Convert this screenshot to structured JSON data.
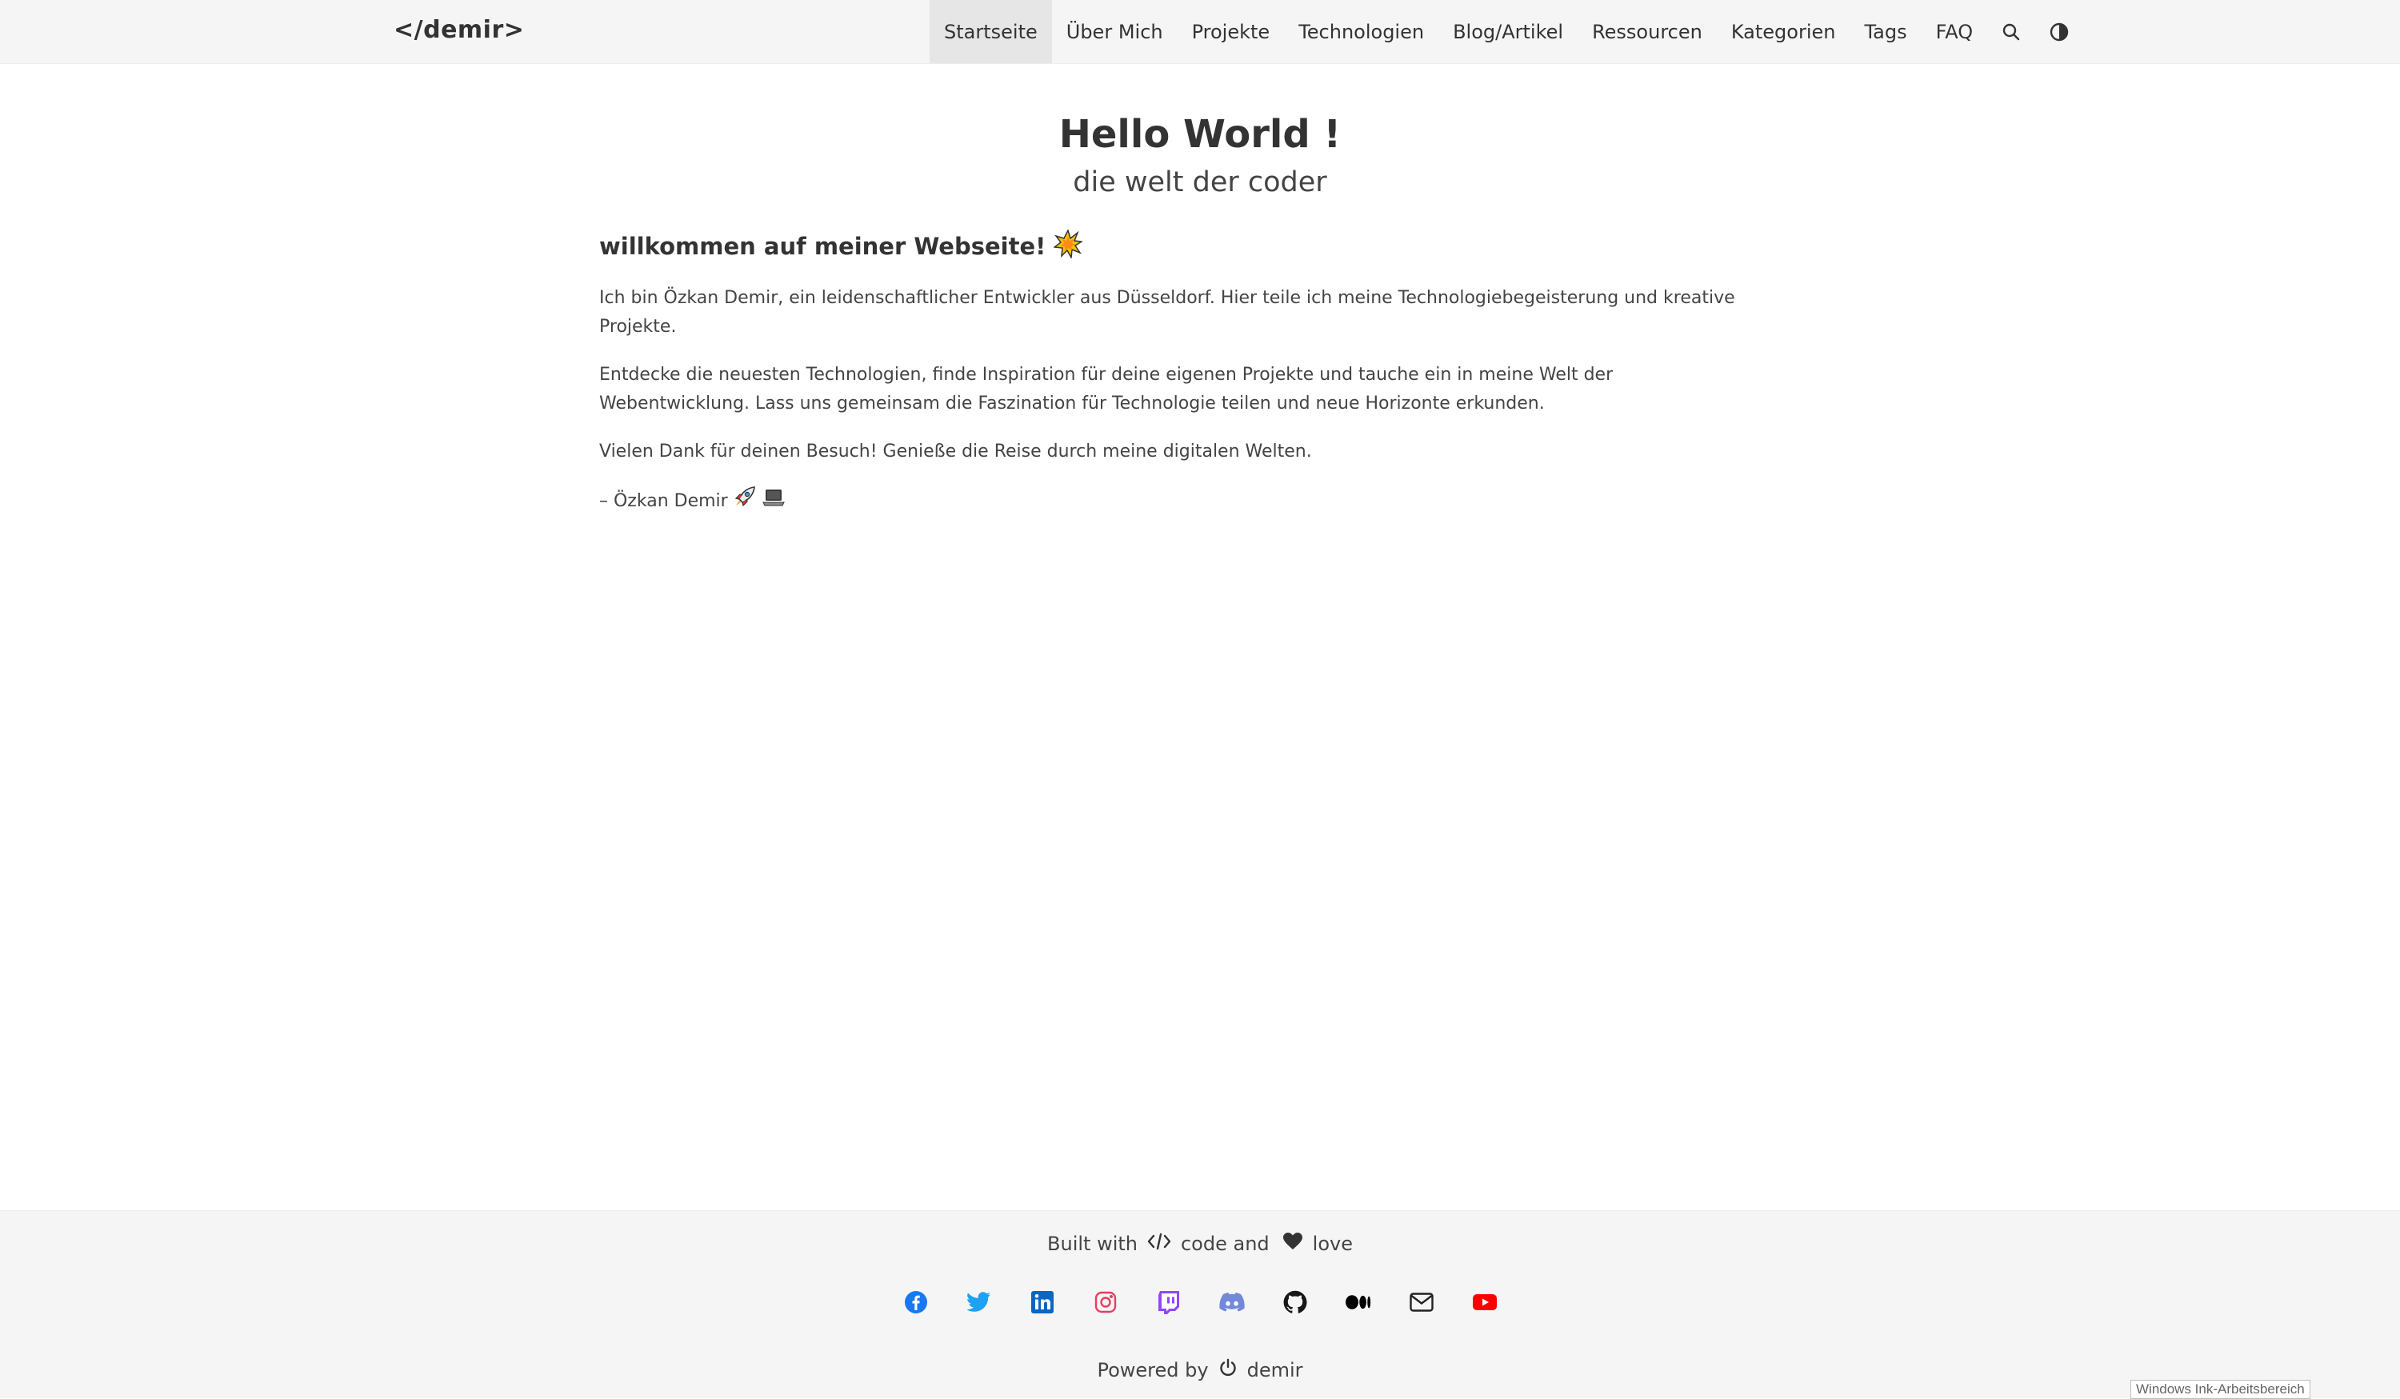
{
  "brand": "</demir>",
  "nav": {
    "items": [
      {
        "label": "Startseite",
        "active": true
      },
      {
        "label": "Über Mich"
      },
      {
        "label": "Projekte"
      },
      {
        "label": "Technologien"
      },
      {
        "label": "Blog/Artikel"
      },
      {
        "label": "Ressourcen"
      },
      {
        "label": "Kategorien"
      },
      {
        "label": "Tags"
      },
      {
        "label": "FAQ"
      }
    ],
    "icons": [
      "search-icon",
      "theme-toggle-icon"
    ]
  },
  "hero": {
    "title": "Hello World !",
    "subtitle": "die welt der coder"
  },
  "content": {
    "heading": "willkommen auf meiner Webseite!",
    "heading_emoji": "collision-emoji",
    "p1": "Ich bin Özkan Demir, ein leidenschaftlicher Entwickler aus Düsseldorf. Hier teile ich meine Technologiebegeisterung und kreative Projekte.",
    "p2": "Entdecke die neuesten Technologien, finde Inspiration für deine eigenen Projekte und tauche ein in meine Welt der Webentwicklung. Lass uns gemeinsam die Faszination für Technologie teilen und neue Horizonte erkunden.",
    "p3": "Vielen Dank für deinen Besuch! Genieße die Reise durch meine digitalen Welten.",
    "signature": "– Özkan Demir",
    "signature_emojis": [
      "rocket-emoji",
      "laptop-emoji"
    ]
  },
  "footer": {
    "built_prefix": "Built with",
    "built_code": "code and",
    "built_love": "love",
    "powered_prefix": "Powered by",
    "powered_name": "demir",
    "social": [
      {
        "name": "facebook-icon",
        "color": "#1877f2"
      },
      {
        "name": "twitter-icon",
        "color": "#1da1f2"
      },
      {
        "name": "linkedin-icon",
        "color": "#0a66c2"
      },
      {
        "name": "instagram-icon",
        "color": "#e4405f"
      },
      {
        "name": "twitch-icon",
        "color": "#9146ff"
      },
      {
        "name": "discord-icon",
        "color": "#7289da"
      },
      {
        "name": "github-icon",
        "color": "#181717"
      },
      {
        "name": "medium-icon",
        "color": "#000000"
      },
      {
        "name": "email-icon",
        "color": "#222222"
      },
      {
        "name": "youtube-icon",
        "color": "#ff0000"
      }
    ]
  },
  "ink_badge": "Windows Ink-Arbeitsbereich"
}
